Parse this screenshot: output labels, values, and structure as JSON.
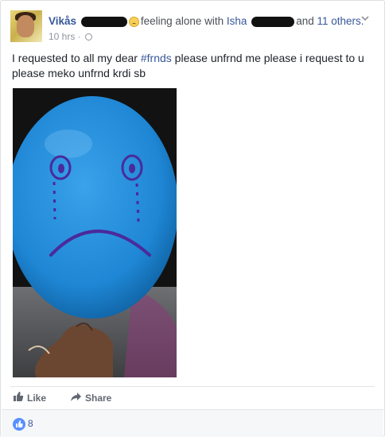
{
  "post": {
    "author": "Vikås",
    "feeling_text": "feeling alone with",
    "tagged_name": "Isha",
    "and_text": "and",
    "others_link": "11 others.",
    "timestamp": "10 hrs",
    "separator": "·",
    "body_prefix": "I requested to all my dear ",
    "hashtag": "#frnds",
    "body_suffix": " please unfrnd me please i request to u please meko unfrnd krdi sb"
  },
  "actions": {
    "like_label": "Like",
    "share_label": "Share"
  },
  "reactions": {
    "count": "8"
  },
  "colors": {
    "link": "#365899",
    "balloon": "#1f87d6",
    "ink": "#4a2a9c"
  },
  "icons": {
    "feeling": "sad-face-emoji-icon",
    "privacy": "globe-icon",
    "menu": "chevron-down-icon",
    "like": "thumbs-up-icon",
    "share": "share-arrow-icon",
    "reaction": "like-reaction-icon"
  }
}
